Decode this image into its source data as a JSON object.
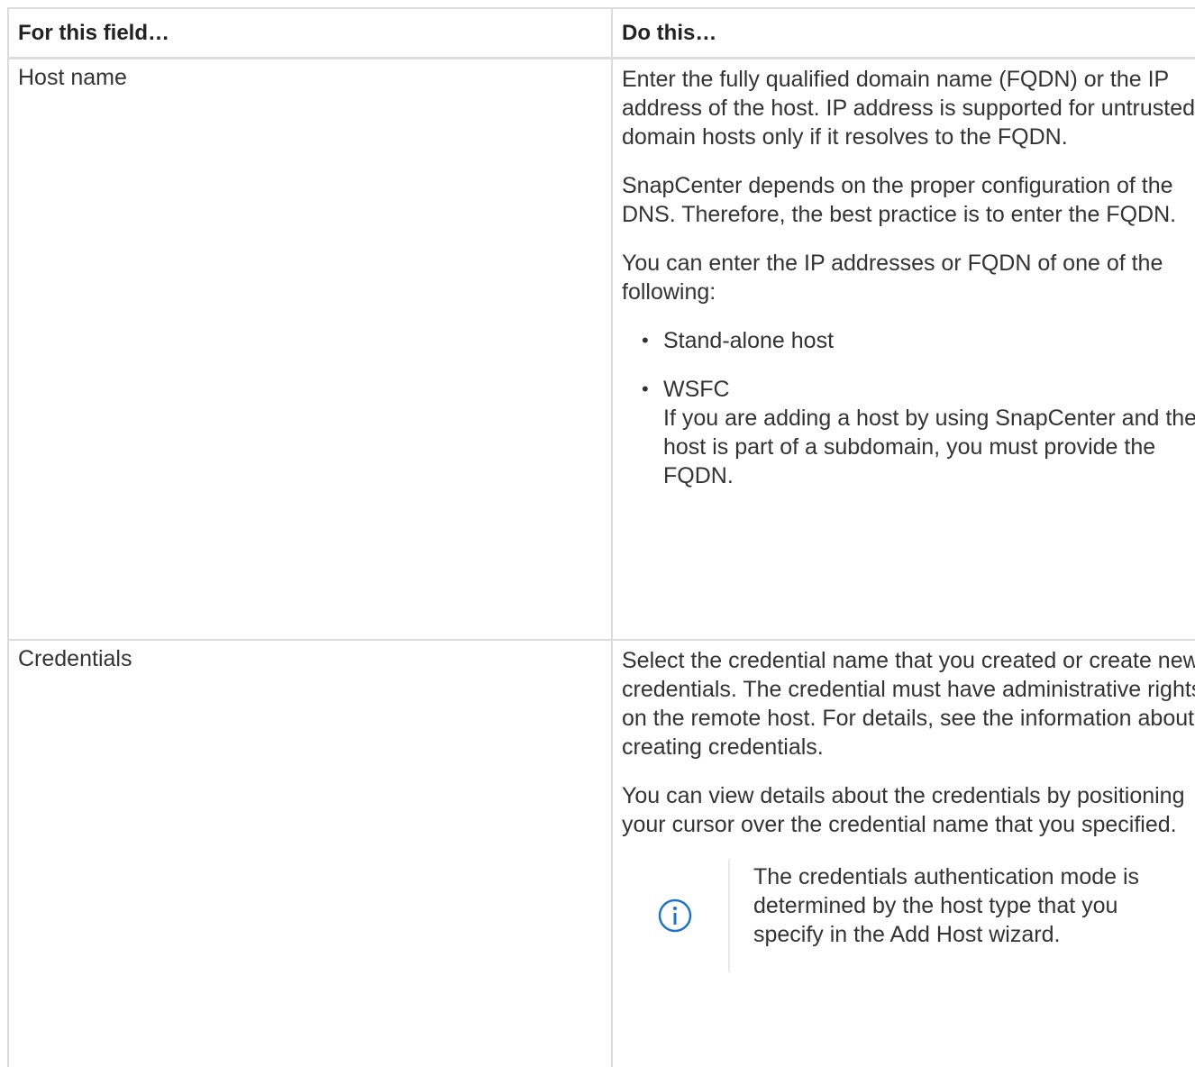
{
  "table": {
    "headers": {
      "field": "For this field…",
      "action": "Do this…"
    },
    "rows": [
      {
        "field": "Host name",
        "paragraphs": [
          "Enter the fully qualified domain name (FQDN) or the IP address of the host. IP address is supported for untrusted domain hosts only if it resolves to the FQDN.",
          "SnapCenter depends on the proper configuration of the DNS. Therefore, the best practice is to enter the FQDN.",
          "You can enter the IP addresses or FQDN of one of the following:"
        ],
        "bullets": [
          {
            "title": "Stand-alone host"
          },
          {
            "title": "WSFC",
            "detail": "If you are adding a host by using SnapCenter and the host is part of a subdomain, you must provide the FQDN."
          }
        ]
      },
      {
        "field": "Credentials",
        "paragraphs": [
          "Select the credential name that you created or create new credentials. The credential must have administrative rights on the remote host. For details, see the information about creating credentials.",
          "You can view details about the credentials by positioning your cursor over the credential name that you specified."
        ],
        "note": {
          "icon": "info-icon",
          "text": "The credentials authentication mode is determined by the host type that you specify in the Add Host wizard."
        }
      }
    ]
  },
  "colors": {
    "border": "#dcdcdc",
    "text": "#333333",
    "info_icon": "#1f73c6"
  }
}
